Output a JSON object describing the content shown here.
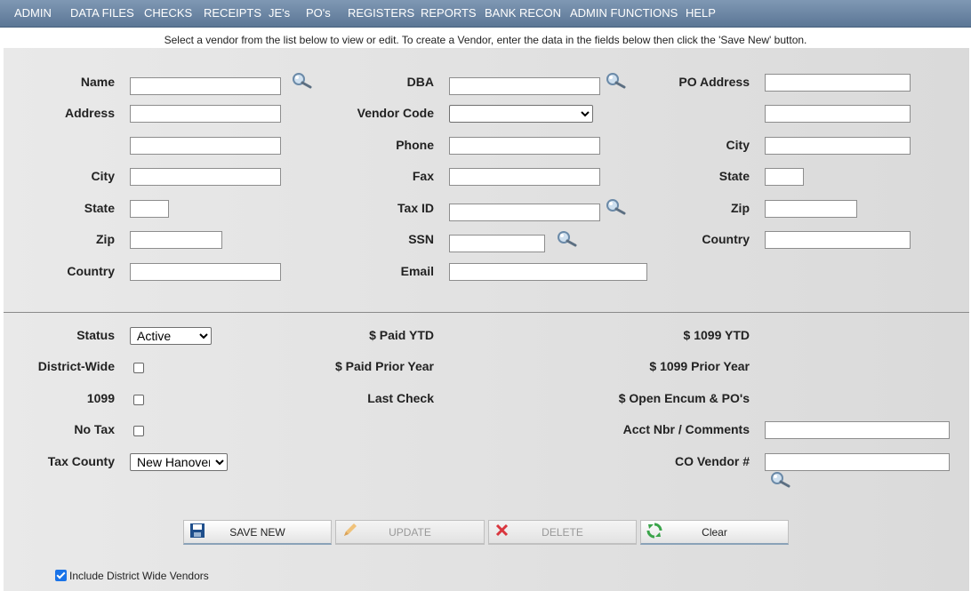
{
  "menu": [
    "ADMIN",
    "DATA FILES",
    "CHECKS",
    "RECEIPTS",
    "JE's",
    "PO's",
    "REGISTERS",
    "REPORTS",
    "BANK RECON",
    "ADMIN FUNCTIONS",
    "HELP"
  ],
  "instructions": "Select a vendor from the list below to view or edit. To create a Vendor, enter the data in the fields below then click the 'Save New' button.",
  "labels": {
    "name": "Name",
    "address": "Address",
    "city": "City",
    "state": "State",
    "zip": "Zip",
    "country": "Country",
    "dba": "DBA",
    "vendor_code": "Vendor Code",
    "phone": "Phone",
    "fax": "Fax",
    "tax_id": "Tax ID",
    "ssn": "SSN",
    "email": "Email",
    "po_address": "PO Address",
    "po_city": "City",
    "po_state": "State",
    "po_zip": "Zip",
    "po_country": "Country",
    "status": "Status",
    "district_wide": "District-Wide",
    "f1099": "1099",
    "no_tax": "No Tax",
    "tax_county": "Tax County",
    "paid_ytd": "$ Paid YTD",
    "paid_prior": "$ Paid Prior Year",
    "last_check": "Last Check",
    "ytd_1099": "$ 1099 YTD",
    "prior_1099": "$ 1099 Prior Year",
    "open_encum": "$ Open Encum & PO's",
    "acct_nbr": "Acct Nbr / Comments",
    "co_vendor": "CO Vendor #"
  },
  "selects": {
    "vendor_code": "",
    "status": "Active",
    "tax_county": "New Hanover"
  },
  "checkboxes": {
    "district_wide": false,
    "f1099": false,
    "no_tax": false,
    "include_district_wide": true
  },
  "buttons": {
    "save_new": "SAVE NEW",
    "update": "UPDATE",
    "delete": "DELETE",
    "clear": "Clear"
  },
  "include_label": "Include District Wide Vendors",
  "icons": {
    "search": "magnifier-icon",
    "save": "floppy-icon",
    "update": "pencil-icon",
    "delete": "x-icon",
    "clear": "refresh-icon"
  }
}
